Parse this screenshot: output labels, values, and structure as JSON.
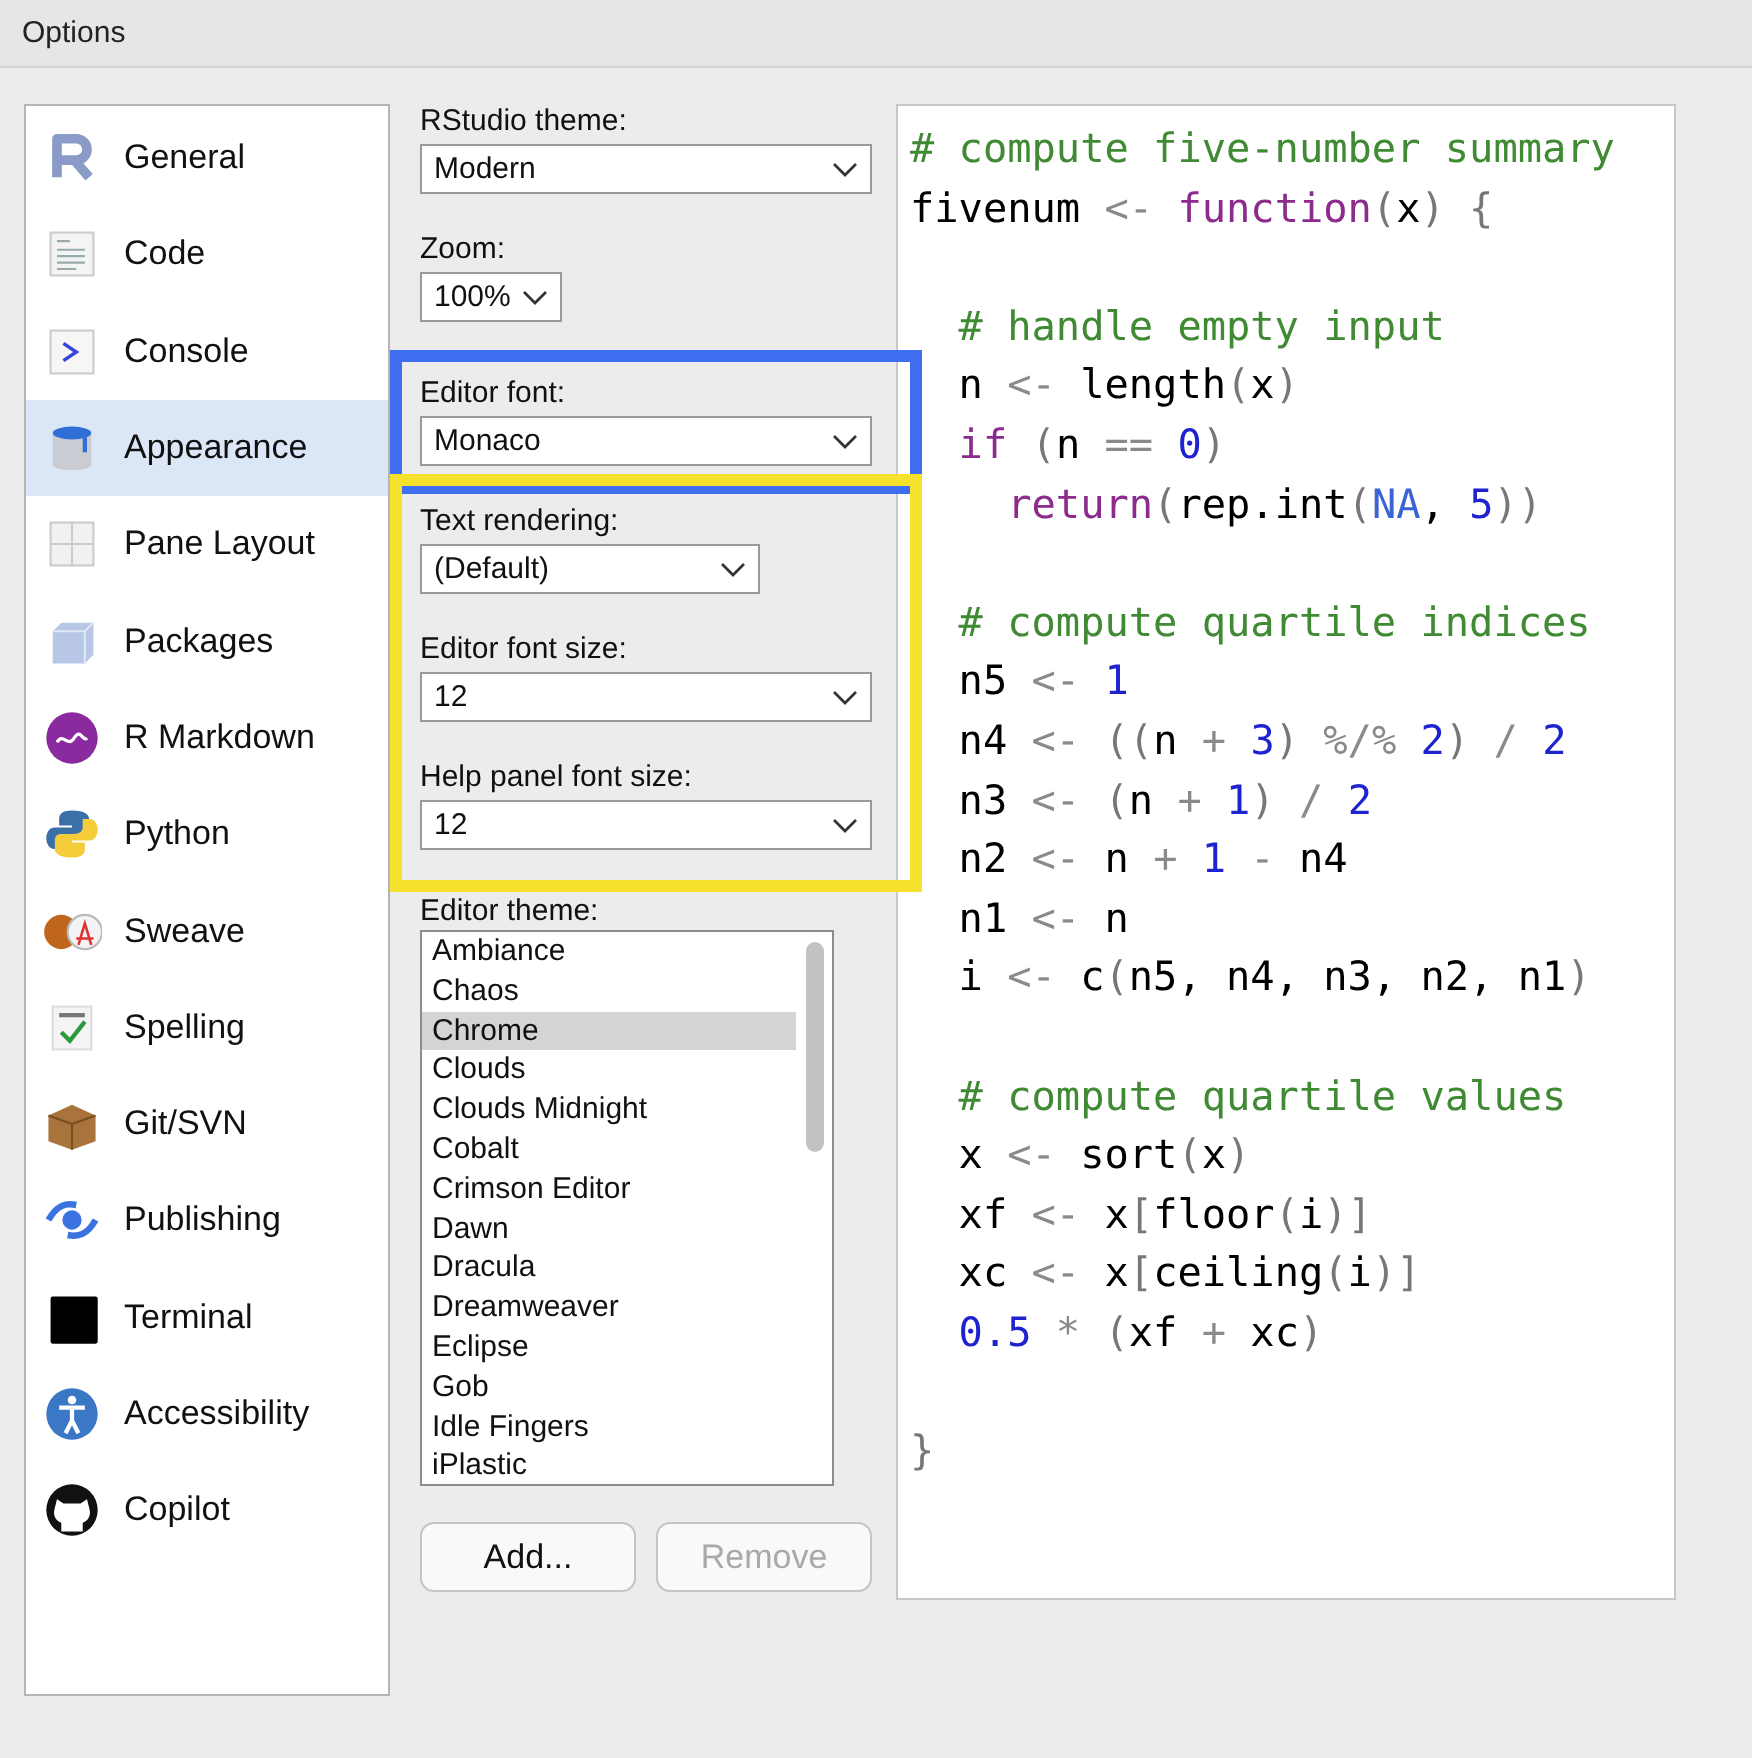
{
  "window": {
    "title": "Options"
  },
  "sidebar": {
    "items": [
      {
        "label": "General",
        "selected": false
      },
      {
        "label": "Code",
        "selected": false
      },
      {
        "label": "Console",
        "selected": false
      },
      {
        "label": "Appearance",
        "selected": true
      },
      {
        "label": "Pane Layout",
        "selected": false
      },
      {
        "label": "Packages",
        "selected": false
      },
      {
        "label": "R Markdown",
        "selected": false
      },
      {
        "label": "Python",
        "selected": false
      },
      {
        "label": "Sweave",
        "selected": false
      },
      {
        "label": "Spelling",
        "selected": false
      },
      {
        "label": "Git/SVN",
        "selected": false
      },
      {
        "label": "Publishing",
        "selected": false
      },
      {
        "label": "Terminal",
        "selected": false
      },
      {
        "label": "Accessibility",
        "selected": false
      },
      {
        "label": "Copilot",
        "selected": false
      }
    ]
  },
  "appearance": {
    "groups": [
      {
        "fields": [
          {
            "label": "RStudio theme:",
            "value": "Modern",
            "kind": "full"
          },
          {
            "label": "Zoom:",
            "value": "100%",
            "kind": "compact"
          }
        ]
      },
      {
        "color": "#3f6ff0",
        "fields": [
          {
            "label": "Editor font:",
            "value": "Monaco",
            "kind": "full"
          }
        ]
      },
      {
        "color": "#f6e22c",
        "fields": [
          {
            "label": "Text rendering:",
            "value": "(Default)",
            "kind": "medium"
          },
          {
            "label": "Editor font size:",
            "value": "12",
            "kind": "full"
          },
          {
            "label": "Help panel font size:",
            "value": "12",
            "kind": "full"
          }
        ]
      }
    ],
    "editor_theme": {
      "label": "Editor theme:",
      "items": [
        {
          "label": "Ambiance",
          "selected": false
        },
        {
          "label": "Chaos",
          "selected": false
        },
        {
          "label": "Chrome",
          "selected": true
        },
        {
          "label": "Clouds",
          "selected": false
        },
        {
          "label": "Clouds Midnight",
          "selected": false
        },
        {
          "label": "Cobalt",
          "selected": false
        },
        {
          "label": "Crimson Editor",
          "selected": false
        },
        {
          "label": "Dawn",
          "selected": false
        },
        {
          "label": "Dracula",
          "selected": false
        },
        {
          "label": "Dreamweaver",
          "selected": false
        },
        {
          "label": "Eclipse",
          "selected": false
        },
        {
          "label": "Gob",
          "selected": false
        },
        {
          "label": "Idle Fingers",
          "selected": false
        },
        {
          "label": "iPlastic",
          "selected": false
        }
      ]
    },
    "buttons": [
      {
        "label": "Add...",
        "disabled": false
      },
      {
        "label": "Remove",
        "disabled": true
      }
    ]
  },
  "code_preview": {
    "lines": [
      {
        "tokens": [
          {
            "kind": "comment",
            "text": "# compute five-number summary"
          }
        ]
      },
      {
        "tokens": [
          {
            "kind": "text",
            "text": "fivenum "
          },
          {
            "kind": "operator",
            "text": "<- "
          },
          {
            "kind": "keyword",
            "text": "function"
          },
          {
            "kind": "paren",
            "text": "("
          },
          {
            "kind": "text",
            "text": "x"
          },
          {
            "kind": "paren",
            "text": ") {"
          }
        ]
      },
      {
        "blank": true
      },
      {
        "tokens": [
          {
            "kind": "comment",
            "text": "  # handle empty input"
          }
        ]
      },
      {
        "tokens": [
          {
            "kind": "text",
            "text": "  n "
          },
          {
            "kind": "operator",
            "text": "<-"
          },
          {
            "kind": "text",
            "text": " length"
          },
          {
            "kind": "paren",
            "text": "("
          },
          {
            "kind": "text",
            "text": "x"
          },
          {
            "kind": "paren",
            "text": ")"
          }
        ]
      },
      {
        "tokens": [
          {
            "kind": "keyword",
            "text": "  if "
          },
          {
            "kind": "paren",
            "text": "("
          },
          {
            "kind": "text",
            "text": "n "
          },
          {
            "kind": "operator",
            "text": "== "
          },
          {
            "kind": "number",
            "text": "0"
          },
          {
            "kind": "paren",
            "text": ")"
          }
        ]
      },
      {
        "tokens": [
          {
            "kind": "keyword",
            "text": "    return"
          },
          {
            "kind": "paren",
            "text": "("
          },
          {
            "kind": "text",
            "text": "rep.int"
          },
          {
            "kind": "paren",
            "text": "("
          },
          {
            "kind": "constant",
            "text": "NA"
          },
          {
            "kind": "text",
            "text": ", "
          },
          {
            "kind": "number",
            "text": "5"
          },
          {
            "kind": "paren",
            "text": "))"
          }
        ]
      },
      {
        "blank": true
      },
      {
        "tokens": [
          {
            "kind": "comment",
            "text": "  # compute quartile indices"
          }
        ]
      },
      {
        "tokens": [
          {
            "kind": "text",
            "text": "  n5 "
          },
          {
            "kind": "operator",
            "text": "<- "
          },
          {
            "kind": "number",
            "text": "1"
          }
        ]
      },
      {
        "tokens": [
          {
            "kind": "text",
            "text": "  n4 "
          },
          {
            "kind": "operator",
            "text": "<- "
          },
          {
            "kind": "paren",
            "text": "(("
          },
          {
            "kind": "text",
            "text": "n "
          },
          {
            "kind": "operator",
            "text": "+ "
          },
          {
            "kind": "number",
            "text": "3"
          },
          {
            "kind": "paren",
            "text": ") "
          },
          {
            "kind": "operator",
            "text": "%/% "
          },
          {
            "kind": "number",
            "text": "2"
          },
          {
            "kind": "paren",
            "text": ") "
          },
          {
            "kind": "operator",
            "text": "/ "
          },
          {
            "kind": "number",
            "text": "2"
          }
        ]
      },
      {
        "tokens": [
          {
            "kind": "text",
            "text": "  n3 "
          },
          {
            "kind": "operator",
            "text": "<- "
          },
          {
            "kind": "paren",
            "text": "("
          },
          {
            "kind": "text",
            "text": "n "
          },
          {
            "kind": "operator",
            "text": "+ "
          },
          {
            "kind": "number",
            "text": "1"
          },
          {
            "kind": "paren",
            "text": ") "
          },
          {
            "kind": "operator",
            "text": "/ "
          },
          {
            "kind": "number",
            "text": "2"
          }
        ]
      },
      {
        "tokens": [
          {
            "kind": "text",
            "text": "  n2 "
          },
          {
            "kind": "operator",
            "text": "<-"
          },
          {
            "kind": "text",
            "text": " n "
          },
          {
            "kind": "operator",
            "text": "+ "
          },
          {
            "kind": "number",
            "text": "1"
          },
          {
            "kind": "operator",
            "text": " -"
          },
          {
            "kind": "text",
            "text": " n4"
          }
        ]
      },
      {
        "tokens": [
          {
            "kind": "text",
            "text": "  n1 "
          },
          {
            "kind": "operator",
            "text": "<-"
          },
          {
            "kind": "text",
            "text": " n"
          }
        ]
      },
      {
        "tokens": [
          {
            "kind": "text",
            "text": "  i "
          },
          {
            "kind": "operator",
            "text": "<-"
          },
          {
            "kind": "text",
            "text": " c"
          },
          {
            "kind": "paren",
            "text": "("
          },
          {
            "kind": "text",
            "text": "n5, n4, n3, n2, n1"
          },
          {
            "kind": "paren",
            "text": ")"
          }
        ]
      },
      {
        "blank": true
      },
      {
        "tokens": [
          {
            "kind": "comment",
            "text": "  # compute quartile values"
          }
        ]
      },
      {
        "tokens": [
          {
            "kind": "text",
            "text": "  x "
          },
          {
            "kind": "operator",
            "text": "<-"
          },
          {
            "kind": "text",
            "text": " sort"
          },
          {
            "kind": "paren",
            "text": "("
          },
          {
            "kind": "text",
            "text": "x"
          },
          {
            "kind": "paren",
            "text": ")"
          }
        ]
      },
      {
        "tokens": [
          {
            "kind": "text",
            "text": "  xf "
          },
          {
            "kind": "operator",
            "text": "<-"
          },
          {
            "kind": "text",
            "text": " x"
          },
          {
            "kind": "paren",
            "text": "["
          },
          {
            "kind": "text",
            "text": "floor"
          },
          {
            "kind": "paren",
            "text": "("
          },
          {
            "kind": "text",
            "text": "i"
          },
          {
            "kind": "paren",
            "text": ")]"
          }
        ]
      },
      {
        "tokens": [
          {
            "kind": "text",
            "text": "  xc "
          },
          {
            "kind": "operator",
            "text": "<-"
          },
          {
            "kind": "text",
            "text": " x"
          },
          {
            "kind": "paren",
            "text": "["
          },
          {
            "kind": "text",
            "text": "ceiling"
          },
          {
            "kind": "paren",
            "text": "("
          },
          {
            "kind": "text",
            "text": "i"
          },
          {
            "kind": "paren",
            "text": ")]"
          }
        ]
      },
      {
        "tokens": [
          {
            "kind": "number",
            "text": "  0.5"
          },
          {
            "kind": "operator",
            "text": " * "
          },
          {
            "kind": "paren",
            "text": "("
          },
          {
            "kind": "text",
            "text": "xf "
          },
          {
            "kind": "operator",
            "text": "+"
          },
          {
            "kind": "text",
            "text": " xc"
          },
          {
            "kind": "paren",
            "text": ")"
          }
        ]
      },
      {
        "blank": true
      },
      {
        "tokens": [
          {
            "kind": "paren",
            "text": "}"
          }
        ]
      }
    ]
  }
}
